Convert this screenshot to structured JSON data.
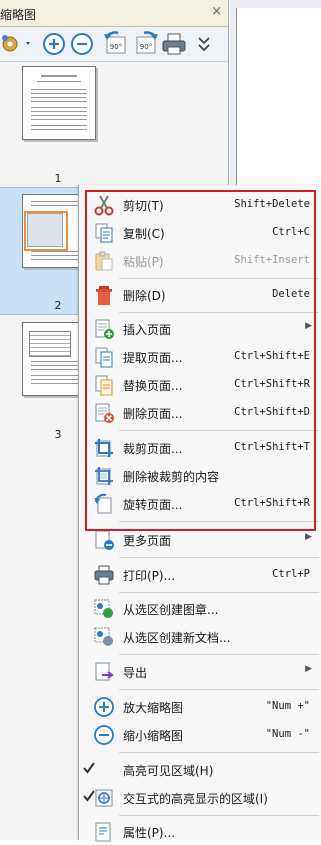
{
  "pane": {
    "title": "缩略图",
    "close": "×",
    "thumbnails": [
      {
        "label": "1"
      },
      {
        "label": "2"
      },
      {
        "label": "3"
      }
    ]
  },
  "toolbar": {
    "icons": [
      "gear-icon",
      "zoom-in-icon",
      "zoom-out-icon",
      "rotate-left-icon",
      "rotate-right-icon",
      "print-icon",
      "more-icon"
    ],
    "rotate_left_label": "90°",
    "rotate_right_label": "90°"
  },
  "menu": {
    "items": [
      {
        "label": "剪切(T)",
        "shortcut": "Shift+Delete",
        "icon": "scissors-icon"
      },
      {
        "label": "复制(C)",
        "shortcut": "Ctrl+C",
        "icon": "copy-icon"
      },
      {
        "label": "粘贴(P)",
        "shortcut": "Shift+Insert",
        "icon": "paste-icon",
        "disabled": true
      },
      {
        "label": "删除(D)",
        "shortcut": "Delete",
        "icon": "trash-icon"
      },
      {
        "label": "插入页面",
        "shortcut": "",
        "icon": "insert-page-icon",
        "submenu": true
      },
      {
        "label": "提取页面...",
        "shortcut": "Ctrl+Shift+E",
        "icon": "extract-page-icon"
      },
      {
        "label": "替换页面...",
        "shortcut": "Ctrl+Shift+R",
        "icon": "replace-page-icon"
      },
      {
        "label": "删除页面...",
        "shortcut": "Ctrl+Shift+D",
        "icon": "delete-page-icon"
      },
      {
        "label": "裁剪页面...",
        "shortcut": "Ctrl+Shift+T",
        "icon": "crop-page-icon"
      },
      {
        "label": "删除被裁剪的内容",
        "shortcut": "",
        "icon": "remove-cropped-icon"
      },
      {
        "label": "旋转页面...",
        "shortcut": "Ctrl+Shift+R",
        "icon": "rotate-page-icon"
      },
      {
        "label": "更多页面",
        "shortcut": "",
        "icon": "more-pages-icon",
        "submenu": true
      },
      {
        "label": "打印(P)...",
        "shortcut": "Ctrl+P",
        "icon": "print-icon"
      },
      {
        "label": "从选区创建图章...",
        "shortcut": "",
        "icon": "create-stamp-icon"
      },
      {
        "label": "从选区创建新文档...",
        "shortcut": "",
        "icon": "create-document-icon"
      },
      {
        "label": "导出",
        "shortcut": "",
        "icon": "export-icon",
        "submenu": true
      },
      {
        "label": "放大缩略图",
        "shortcut": "\"Num +\"",
        "icon": "enlarge-thumbnail-icon"
      },
      {
        "label": "缩小缩略图",
        "shortcut": "\"Num -\"",
        "icon": "shrink-thumbnail-icon"
      },
      {
        "label": "高亮可见区域(H)",
        "shortcut": "",
        "icon": "highlight-visible-icon",
        "checked": true
      },
      {
        "label": "交互式的高亮显示的区域(I)",
        "shortcut": "",
        "icon": "interactive-highlight-icon",
        "checked": true
      },
      {
        "label": "属性(P)...",
        "shortcut": "",
        "icon": "properties-icon"
      }
    ]
  },
  "colors": {
    "highlight_border": "#d11d25",
    "selection": "#cce0f5",
    "accent_blue": "#2b78c5"
  }
}
